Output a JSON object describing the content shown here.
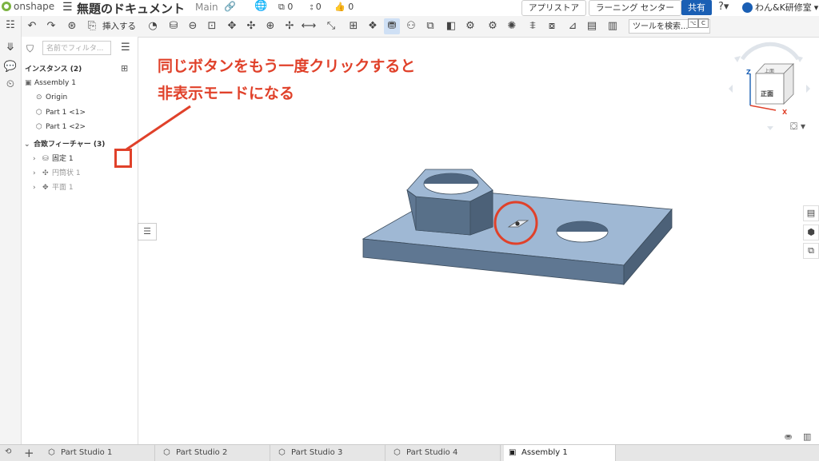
{
  "app": {
    "logo_text": "onshape",
    "doc_title": "無題のドキュメント",
    "branch": "Main",
    "counts": [
      "0",
      "0",
      "0"
    ],
    "app_store": "アプリストア",
    "learning_center": "ラーニング センター",
    "share": "共有",
    "help": "?▾",
    "user": "わん&K研修室"
  },
  "toolbar": {
    "insert_label": "挿入する",
    "search_label": "ツールを検索...",
    "search_shortcut": [
      "⌥",
      "C"
    ],
    "selected_tool": "instance-visibility-tool"
  },
  "panel": {
    "filter_placeholder": "名前でフィルタ...",
    "instances_header": "インスタンス (2)",
    "tree": [
      {
        "label": "Assembly 1"
      },
      {
        "label": "Origin"
      },
      {
        "label": "Part 1 <1>"
      },
      {
        "label": "Part 1 <2>"
      }
    ],
    "mates_header": "合致フィーチャー (3)",
    "mates": [
      {
        "label": "固定 1",
        "muted": false
      },
      {
        "label": "円筒状 1",
        "muted": true
      },
      {
        "label": "平面 1",
        "muted": true
      }
    ]
  },
  "annotation": {
    "line1": "同じボタンをもう一度クリックすると",
    "line2": "非表示モードになる"
  },
  "viewcube": {
    "front_label": "正面",
    "top_label": "上面",
    "axis_z": "Z",
    "axis_x": "X"
  },
  "tabs": [
    {
      "label": "Part Studio 1",
      "active": false
    },
    {
      "label": "Part Studio 2",
      "active": false
    },
    {
      "label": "Part Studio 3",
      "active": false
    },
    {
      "label": "Part Studio 4",
      "active": false
    },
    {
      "label": "Assembly 1",
      "active": true
    }
  ],
  "colors": {
    "part_top": "#9fb8d4",
    "part_side": "#5f7792",
    "annotation": "#e0412a",
    "accent": "#1a5fb4"
  }
}
